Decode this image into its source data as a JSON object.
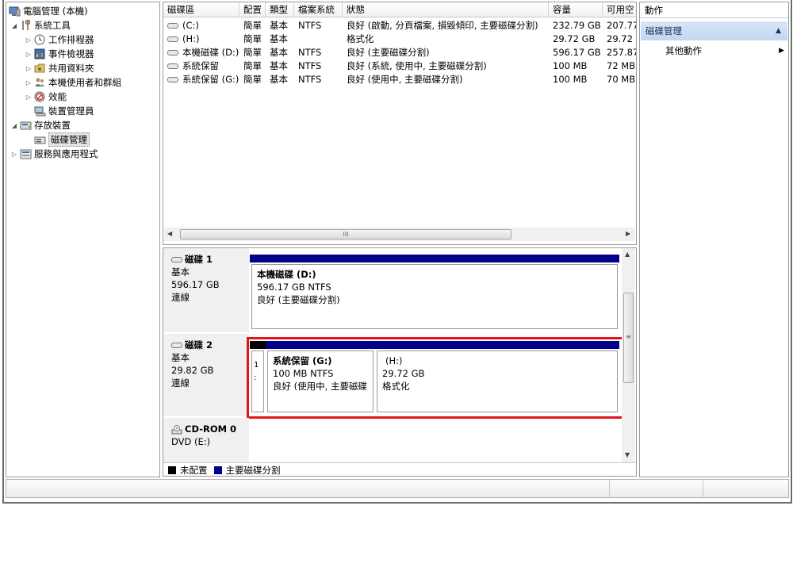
{
  "tree": {
    "items": [
      {
        "label": "電腦管理 (本機)",
        "indent": 0,
        "twisty": "",
        "icon": "computer-icon"
      },
      {
        "label": "系統工具",
        "indent": 1,
        "twisty": "◢",
        "icon": "tools-icon"
      },
      {
        "label": "工作排程器",
        "indent": 2,
        "twisty": "▷",
        "icon": "clock-icon"
      },
      {
        "label": "事件檢視器",
        "indent": 2,
        "twisty": "▷",
        "icon": "event-viewer-icon"
      },
      {
        "label": "共用資料夾",
        "indent": 2,
        "twisty": "▷",
        "icon": "shared-folder-icon"
      },
      {
        "label": "本機使用者和群組",
        "indent": 2,
        "twisty": "▷",
        "icon": "users-icon"
      },
      {
        "label": "效能",
        "indent": 2,
        "twisty": "▷",
        "icon": "performance-icon"
      },
      {
        "label": "裝置管理員",
        "indent": 2,
        "twisty": "",
        "icon": "device-manager-icon"
      },
      {
        "label": "存放裝置",
        "indent": 1,
        "twisty": "◢",
        "icon": "storage-icon"
      },
      {
        "label": "磁碟管理",
        "indent": 2,
        "twisty": "",
        "icon": "disk-management-icon",
        "selected": true
      },
      {
        "label": "服務與應用程式",
        "indent": 1,
        "twisty": "▷",
        "icon": "services-icon"
      }
    ]
  },
  "volumes": {
    "columns": [
      "磁碟區",
      "配置",
      "類型",
      "檔案系統",
      "狀態",
      "容量",
      "可用空"
    ],
    "rows": [
      [
        "(C:)",
        "簡單",
        "基本",
        "NTFS",
        "良好 (啟動, 分頁檔案, 損毀傾印, 主要磁碟分割)",
        "232.79 GB",
        "207.77"
      ],
      [
        "(H:)",
        "簡單",
        "基本",
        "",
        "格式化",
        "29.72 GB",
        "29.72"
      ],
      [
        "本機磁碟 (D:)",
        "簡單",
        "基本",
        "NTFS",
        "良好 (主要磁碟分割)",
        "596.17 GB",
        "257.87"
      ],
      [
        "系統保留",
        "簡單",
        "基本",
        "NTFS",
        "良好 (系統, 使用中, 主要磁碟分割)",
        "100 MB",
        "72 MB"
      ],
      [
        "系統保留 (G:)",
        "簡單",
        "基本",
        "NTFS",
        "良好 (使用中, 主要磁碟分割)",
        "100 MB",
        "70 MB"
      ]
    ],
    "scroll_grip": "III"
  },
  "disks": {
    "disk1": {
      "name": "磁碟 1",
      "type": "基本",
      "size": "596.17 GB",
      "status": "連線",
      "partition": {
        "title": "本機磁碟 (D:)",
        "size": "596.17 GB NTFS",
        "status": "良好 (主要磁碟分割)"
      }
    },
    "disk2": {
      "name": "磁碟 2",
      "type": "基本",
      "size": "29.82 GB",
      "status": "連線",
      "small_partition": {
        "line1": "1",
        "line2": ":"
      },
      "partition_g": {
        "title": "系統保留 (G:)",
        "size": "100 MB NTFS",
        "status": "良好 (使用中, 主要磁碟"
      },
      "partition_h": {
        "title": "(H:)",
        "size": "29.72 GB",
        "status": "格式化"
      }
    },
    "cdrom": {
      "name": "CD-ROM 0",
      "drive": "DVD (E:)"
    },
    "vscroll_grip": "≡"
  },
  "legend": {
    "unallocated": "未配置",
    "primary": "主要磁碟分割"
  },
  "actions": {
    "header": "動作",
    "section": "磁碟管理",
    "item": "其他動作"
  },
  "colors": {
    "primary_partition": "#00008b",
    "unallocated": "#000000",
    "highlight": "#e0151b",
    "action_section": "#c3d6ef"
  }
}
